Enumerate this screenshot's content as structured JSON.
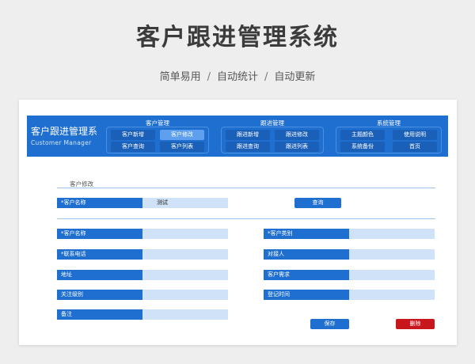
{
  "hero": {
    "title": "客户跟进管理系统",
    "subtitle_parts": [
      "简单易用",
      "/",
      "自动统计",
      "/",
      "自动更新"
    ]
  },
  "app": {
    "name_cn": "客户跟进管理系",
    "name_en": "Customer Manager"
  },
  "menu": {
    "groups": [
      {
        "title": "客户管理",
        "items": [
          "客户新增",
          "客户修改",
          "客户查询",
          "客户列表"
        ],
        "active_index": 1
      },
      {
        "title": "跟进管理",
        "items": [
          "跟进新增",
          "跟进修改",
          "跟进查询",
          "跟进列表"
        ]
      },
      {
        "title": "系统管理",
        "items": [
          "主题颜色",
          "使用说明",
          "系统备份",
          "首页"
        ]
      }
    ]
  },
  "section": {
    "label": "客户修改"
  },
  "query": {
    "label": "*客户名称",
    "value": "测试",
    "button": "查询"
  },
  "form": {
    "customer_name": {
      "label": "*客户名称",
      "value": ""
    },
    "contact_phone": {
      "label": "*联系电话",
      "value": ""
    },
    "address": {
      "label": "地址",
      "value": ""
    },
    "attention_level": {
      "label": "关注级别",
      "value": ""
    },
    "remarks": {
      "label": "备注",
      "value": ""
    },
    "customer_type": {
      "label": "*客户类别",
      "value": ""
    },
    "contact_person": {
      "label": "对接人",
      "value": ""
    },
    "customer_demand": {
      "label": "客户需求",
      "value": ""
    },
    "register_time": {
      "label": "登记时间",
      "value": ""
    }
  },
  "actions": {
    "save": "保存",
    "delete": "删除"
  },
  "colors": {
    "primary": "#1e6fcf",
    "active_tab": "#5ea0ee",
    "input_bg": "#cfe2f7",
    "danger": "#c8161d"
  }
}
